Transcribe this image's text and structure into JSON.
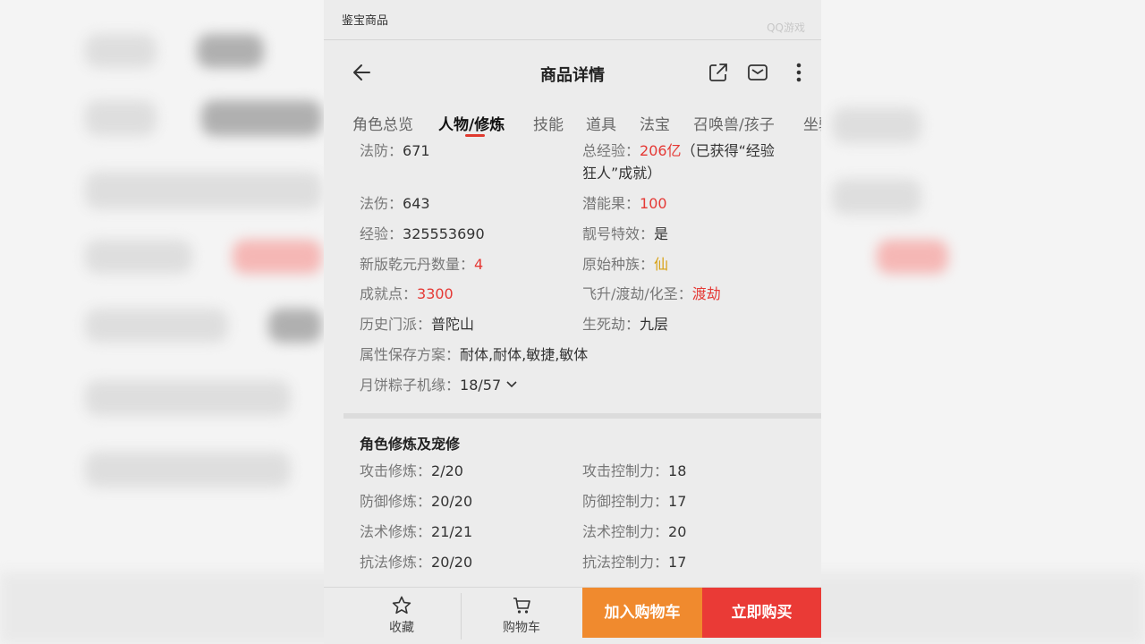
{
  "topbar": {
    "app_title": "鉴宝商品",
    "watermark": "QQ游戏"
  },
  "header": {
    "title": "商品详情"
  },
  "tabs": [
    {
      "label": "角色总览",
      "active": false
    },
    {
      "label": "人物/修炼",
      "active": true
    },
    {
      "label": "技能",
      "active": false
    },
    {
      "label": "道具",
      "active": false
    },
    {
      "label": "法宝",
      "active": false
    },
    {
      "label": "召唤兽/孩子",
      "active": false
    },
    {
      "label": "坐骑",
      "active": false
    }
  ],
  "stats": {
    "fafang": {
      "label": "法防：",
      "value": "671"
    },
    "total_exp": {
      "label": "总经验：",
      "value": "206亿",
      "note_line1": "（已获得“经验",
      "note_line2": "狂人”成就）"
    },
    "fashang": {
      "label": "法伤：",
      "value": "643"
    },
    "potential_fruit": {
      "label": "潜能果：",
      "value": "100"
    },
    "exp": {
      "label": "经验：",
      "value": "325553690"
    },
    "pretty_id": {
      "label": "靓号特效：",
      "value": "是"
    },
    "qianyuan": {
      "label": "新版乾元丹数量：",
      "value": "4"
    },
    "origin_race": {
      "label": "原始种族：",
      "value": "仙"
    },
    "achievement": {
      "label": "成就点：",
      "value": "3300"
    },
    "ascension": {
      "label": "飞升/渡劫/化圣：",
      "value": "渡劫"
    },
    "history_school": {
      "label": "历史门派：",
      "value": "普陀山"
    },
    "life_death": {
      "label": "生死劫：",
      "value": "九层"
    },
    "attr_plan": {
      "label": "属性保存方案：",
      "value": "耐体,耐体,敏捷,敏体"
    },
    "mooncake": {
      "label": "月饼粽子机缘：",
      "value": "18/57"
    }
  },
  "cultivation": {
    "title": "角色修炼及宠修",
    "left": [
      {
        "label": "攻击修炼：",
        "value": "2/20"
      },
      {
        "label": "防御修炼：",
        "value": "20/20"
      },
      {
        "label": "法术修炼：",
        "value": "21/21"
      },
      {
        "label": "抗法修炼：",
        "value": "20/20"
      }
    ],
    "right": [
      {
        "label": "攻击控制力：",
        "value": "18"
      },
      {
        "label": "防御控制力：",
        "value": "17"
      },
      {
        "label": "法术控制力：",
        "value": "20"
      },
      {
        "label": "抗法控制力：",
        "value": "17"
      }
    ]
  },
  "bottom_bar": {
    "favorite_label": "收藏",
    "cart_label": "购物车",
    "add_to_cart": "加入购物车",
    "buy_now": "立即购买"
  },
  "colors": {
    "accent_red": "#e53935",
    "gold": "#d8a011",
    "cart_orange": "#f08a2e",
    "buy_red": "#ea3a36"
  }
}
